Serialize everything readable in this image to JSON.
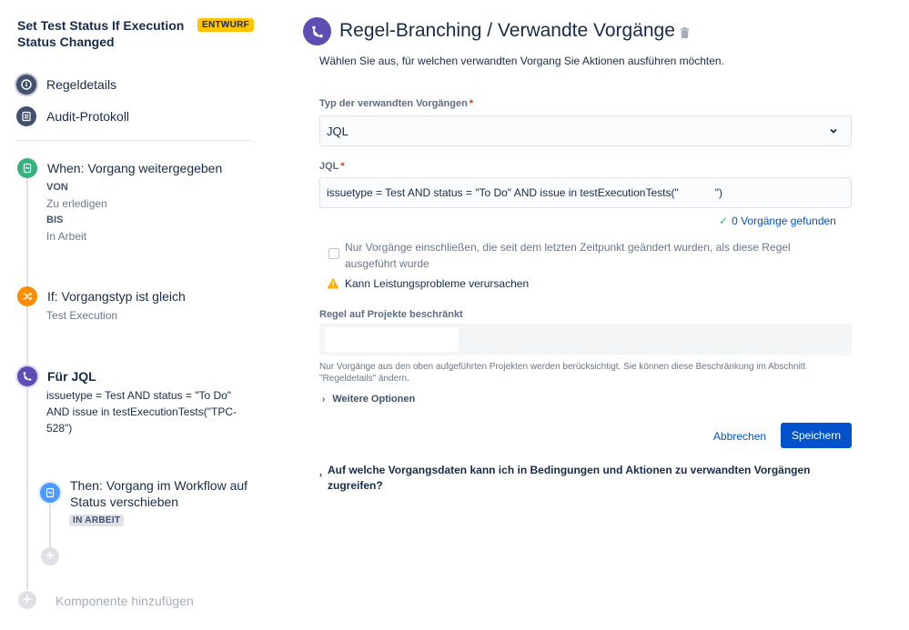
{
  "sidebar": {
    "rule_title": "Set Test Status If Execution Status Changed",
    "draft_badge": "ENTWURF",
    "nav": [
      {
        "label": "Regeldetails",
        "icon": "info-icon"
      },
      {
        "label": "Audit-Protokoll",
        "icon": "list-icon"
      }
    ],
    "trigger": {
      "title": "When: Vorgang weitergegeben",
      "from_key": "VON",
      "from_value": "Zu erledigen",
      "to_key": "BIS",
      "to_value": "In Arbeit",
      "color": "#36b37e"
    },
    "condition": {
      "title": "If: Vorgangstyp ist gleich",
      "value": "Test Execution",
      "color": "#ff8b00"
    },
    "branch": {
      "title": "Für JQL",
      "query": "issuetype = Test AND status = \"To Do\" AND issue in testExecutionTests(\"TPC-528\")",
      "color": "#5e4db2"
    },
    "action": {
      "title": "Then: Vorgang im Workflow auf Status verschieben",
      "badge": "IN ARBEIT",
      "color": "#4c9aff"
    },
    "add_component": "Komponente hinzufügen"
  },
  "main": {
    "title": "Regel-Branching / Verwandte Vorgänge",
    "subtitle": "Wählen Sie aus, für welchen verwandten Vorgang Sie Aktionen ausführen möchten.",
    "type_label": "Typ der verwandten Vorgängen",
    "required_mark": "*",
    "type_value": "JQL",
    "jql_label": "JQL",
    "jql_value": "issuetype = Test AND status = \"To Do\" AND issue in testExecutionTests(\"            \")",
    "found_text": "0 Vorgänge gefunden",
    "checkbox_label": "Nur Vorgänge einschließen, die seit dem letzten Zeitpunkt geändert wurden, als diese Regel ausgeführt wurde",
    "warning_text": "Kann Leistungsprobleme verursachen",
    "restrict_label": "Regel auf Projekte beschränkt",
    "help_text": "Nur Vorgänge aus den oben aufgeführten Projekten werden berücksichtigt. Sie können diese Beschränkung im Abschnitt \"Regeldetails\" ändern.",
    "more_options": "Weitere Optionen",
    "cancel_label": "Abbrechen",
    "save_label": "Speichern",
    "faq": "Auf welche Vorgangsdaten kann ich in Bedingungen und Aktionen zu verwandten Vorgängen zugreifen?",
    "accent": "#0052cc"
  }
}
